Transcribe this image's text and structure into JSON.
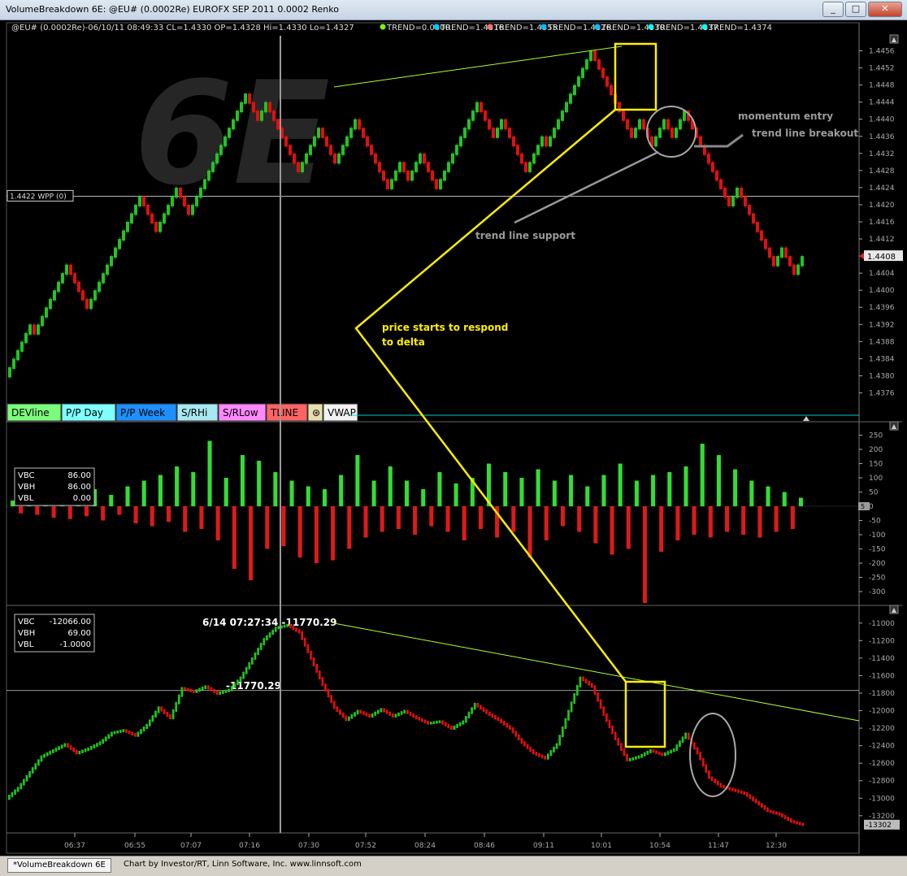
{
  "window": {
    "title": "VolumeBreakdown 6E: @EU# (0.0002Re) EUROFX SEP 2011 0.0002 Renko",
    "min": "_",
    "max": "□",
    "close": "✕"
  },
  "status": {
    "tab_label": "*VolumeBreakdown 6E",
    "credit": "Chart by Investor/RT, Linn Software, Inc. www.linnsoft.com"
  },
  "header": {
    "quote": "@EU# (0.0002Re)-06/10/11 08:49:33 CL=1.4330 OP=1.4328 Hi=1.4330 Lo=1.4327",
    "trends": [
      "TREND=0.0000",
      "TREND=1.4316",
      "TREND=1.4355",
      "TREND=1.4326",
      "TREND=1.4330",
      "TREND=1.4337",
      "TREND=1.4374"
    ],
    "trend_colors": [
      "#7cfc00",
      "#00ccff",
      "#ff7070",
      "#00bfff",
      "#00bfff",
      "#00ffff",
      "#00ffff"
    ]
  },
  "watermark": "6E",
  "pane_buttons": [
    {
      "label": "DEVline",
      "bg": "#7cfc7c",
      "fg": "#000"
    },
    {
      "label": "P/P Day",
      "bg": "#80ffff",
      "fg": "#000"
    },
    {
      "label": "P/P Week",
      "bg": "#1e90ff",
      "fg": "#000"
    },
    {
      "label": "S/RHi",
      "bg": "#a8e8f0",
      "fg": "#000"
    },
    {
      "label": "S/RLow",
      "bg": "#ff88ff",
      "fg": "#000"
    },
    {
      "label": "TLINE",
      "bg": "#ff6464",
      "fg": "#000"
    },
    {
      "label": "⊛",
      "bg": "#e8dfb0",
      "fg": "#000"
    },
    {
      "label": "VWAP",
      "bg": "#f2f2f2",
      "fg": "#000"
    }
  ],
  "annotations": {
    "momentum_entry": "momentum entry",
    "trend_line_breakout": "trend line breakout",
    "trend_line_support": "trend line support",
    "price_responds_1": "price starts to respond",
    "price_responds_2": "to delta",
    "cursor_readout": "6/14 07:27:34 -11770.29",
    "cursor_level": "-11770.29"
  },
  "price_pane": {
    "wpp_label": "1.4422 WPP (0)",
    "last_price": "1.4408",
    "y_ticks": [
      "1.4456",
      "1.4452",
      "1.4448",
      "1.4444",
      "1.4440",
      "1.4436",
      "1.4432",
      "1.4428",
      "1.4424",
      "1.4420",
      "1.4416",
      "1.4412",
      "1.4408",
      "1.4404",
      "1.4400",
      "1.4396",
      "1.4392",
      "1.4388",
      "1.4384",
      "1.4380",
      "1.4376"
    ]
  },
  "delta_pane": {
    "legend": [
      {
        "k": "VBC",
        "v": "86.00"
      },
      {
        "k": "VBH",
        "v": "86.00"
      },
      {
        "k": "VBL",
        "v": "0.00"
      }
    ],
    "y_ticks": [
      "250",
      "200",
      "150",
      "100",
      "50",
      "0",
      "-50",
      "-100",
      "-150",
      "-200",
      "-250",
      "-300"
    ],
    "last": "5"
  },
  "cum_pane": {
    "legend": [
      {
        "k": "VBC",
        "v": "-12066.00"
      },
      {
        "k": "VBH",
        "v": "69.00"
      },
      {
        "k": "VBL",
        "v": "-1.0000"
      }
    ],
    "y_ticks": [
      "-11000",
      "-11200",
      "-11400",
      "-11600",
      "-11800",
      "-12000",
      "-12200",
      "-12400",
      "-12600",
      "-12800",
      "-13000",
      "-13200"
    ],
    "last": "-13302"
  },
  "chart_data": [
    {
      "type": "line",
      "title": "VolumeBreakdown 6E: @EU# (0.0002Re) EUROFX SEP 2011 0.0002 Renko",
      "ylim": [
        1.4374,
        1.4458
      ],
      "x_ticks": [
        "06:37",
        "06:55",
        "07:07",
        "07:16",
        "07:30",
        "07:52",
        "08:24",
        "08:46",
        "09:11",
        "10:01",
        "10:54",
        "11:47",
        "12:30"
      ],
      "series": [
        {
          "values": [
            1.438,
            1.4384,
            1.4388,
            1.4392,
            1.439,
            1.44,
            1.4406,
            1.4396,
            1.4404,
            1.4412,
            1.4416,
            1.4422,
            1.4414,
            1.442,
            1.4424,
            1.4418,
            1.4428,
            1.4434,
            1.444,
            1.4442,
            1.4446,
            1.444,
            1.4444,
            1.4436,
            1.4428,
            1.4438,
            1.443,
            1.444,
            1.4432,
            1.4424,
            1.443,
            1.4426,
            1.4432,
            1.4424,
            1.4428,
            1.4436,
            1.4444,
            1.4436,
            1.444,
            1.4432,
            1.4428,
            1.4436,
            1.4434,
            1.4446,
            1.4456,
            1.445,
            1.4444,
            1.4436,
            1.444,
            1.4434,
            1.444,
            1.4436,
            1.4442,
            1.4432,
            1.4426,
            1.442,
            1.4424,
            1.4416,
            1.4412,
            1.4406,
            1.441,
            1.4404,
            1.4408
          ]
        }
      ]
    },
    {
      "type": "bar",
      "ylim": [
        -340,
        280
      ],
      "series": [
        {
          "values": [
            20,
            -25,
            35,
            -30,
            25,
            -40,
            55,
            -45,
            30,
            -35,
            60,
            -50,
            40,
            -30,
            70,
            -60,
            90,
            -70,
            110,
            -55,
            140,
            -90,
            120,
            -80,
            230,
            -120,
            100,
            -220,
            180,
            -260,
            160,
            -150,
            120,
            -140,
            90,
            -180,
            70,
            -200,
            60,
            -190,
            110,
            -150,
            180,
            -110,
            90,
            -90,
            140,
            -80,
            90,
            -100,
            60,
            -70,
            120,
            -90,
            80,
            -120,
            100,
            -80,
            150,
            -110,
            120,
            -90,
            100,
            -180,
            130,
            -120,
            90,
            -70,
            110,
            -90,
            70,
            -130,
            110,
            -170,
            150,
            -150,
            90,
            -340,
            110,
            -160,
            120,
            -120,
            140,
            -100,
            220,
            -110,
            180,
            -90,
            130,
            -100,
            90,
            -110,
            70,
            -90,
            50,
            -80,
            30
          ]
        }
      ]
    },
    {
      "type": "line",
      "ylim": [
        -13350,
        -10900
      ],
      "series": [
        {
          "values": [
            -13000,
            -12880,
            -12700,
            -12520,
            -12450,
            -12380,
            -12480,
            -12430,
            -12360,
            -12250,
            -12220,
            -12280,
            -12160,
            -11960,
            -12080,
            -11740,
            -11780,
            -11720,
            -11800,
            -11760,
            -11620,
            -11400,
            -11180,
            -11050,
            -11020,
            -11100,
            -11400,
            -11700,
            -11960,
            -12100,
            -12000,
            -12060,
            -11980,
            -12060,
            -12000,
            -12080,
            -12140,
            -12120,
            -12200,
            -12120,
            -11920,
            -12020,
            -12100,
            -12200,
            -12360,
            -12480,
            -12540,
            -12380,
            -12000,
            -11620,
            -11720,
            -12040,
            -12320,
            -12560,
            -12520,
            -12450,
            -12500,
            -12440,
            -12260,
            -12480,
            -12760,
            -12860,
            -12900,
            -12940,
            -13040,
            -13140,
            -13180,
            -13260,
            -13300
          ]
        }
      ]
    }
  ]
}
